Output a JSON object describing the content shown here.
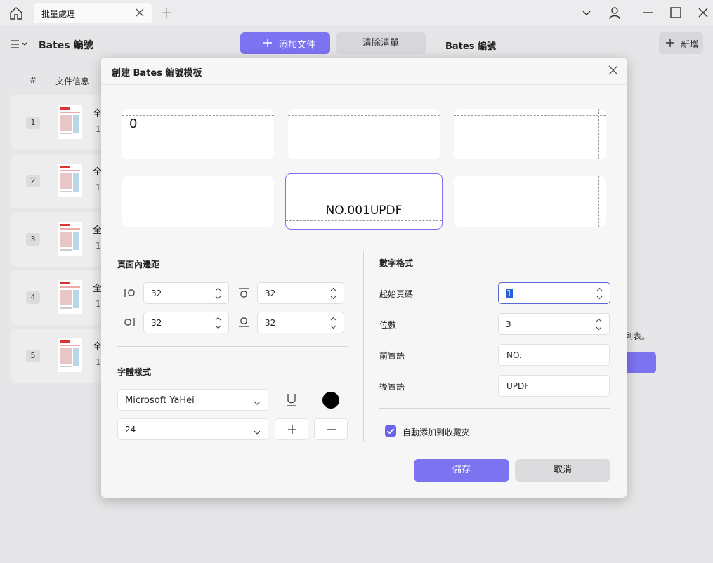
{
  "window": {
    "tab_title": "批量處理"
  },
  "left_panel": {
    "title": "Bates 編號",
    "add_files_label": "添加文件",
    "clear_list_label": "清除清單",
    "col_number": "#",
    "col_info": "文件信息",
    "rows": [
      {
        "index": "1",
        "name": "全",
        "sub": "1"
      },
      {
        "index": "2",
        "name": "全",
        "sub": "1"
      },
      {
        "index": "3",
        "name": "全",
        "sub": "1"
      },
      {
        "index": "4",
        "name": "全",
        "sub": "1"
      },
      {
        "index": "5",
        "name": "全",
        "sub": "1"
      }
    ]
  },
  "right_panel": {
    "title": "Bates 編號",
    "new_label": "新增",
    "hint_text": "列表。"
  },
  "dialog": {
    "title": "創建 Bates 編號模板",
    "preview_top_left": "0",
    "preview_bottom_center": "NO.001UPDF",
    "margins_label": "頁面內邊距",
    "margin_left": "32",
    "margin_top": "32",
    "margin_right": "32",
    "margin_bottom": "32",
    "font_style_label": "字體樣式",
    "font_family": "Microsoft YaHei",
    "font_size": "24",
    "font_color": "#000000",
    "number_format_label": "數字格式",
    "start_page_label": "起始頁碼",
    "start_page_value": "1",
    "digits_label": "位數",
    "digits_value": "3",
    "prefix_label": "前置語",
    "prefix_value": "NO.",
    "suffix_label": "後置語",
    "suffix_value": "UPDF",
    "auto_add_label": "自動添加到收藏夾",
    "auto_add_checked": true,
    "save_label": "儲存",
    "cancel_label": "取消"
  },
  "colors": {
    "accent": "#7b73f0",
    "focus": "#5b67d6"
  }
}
